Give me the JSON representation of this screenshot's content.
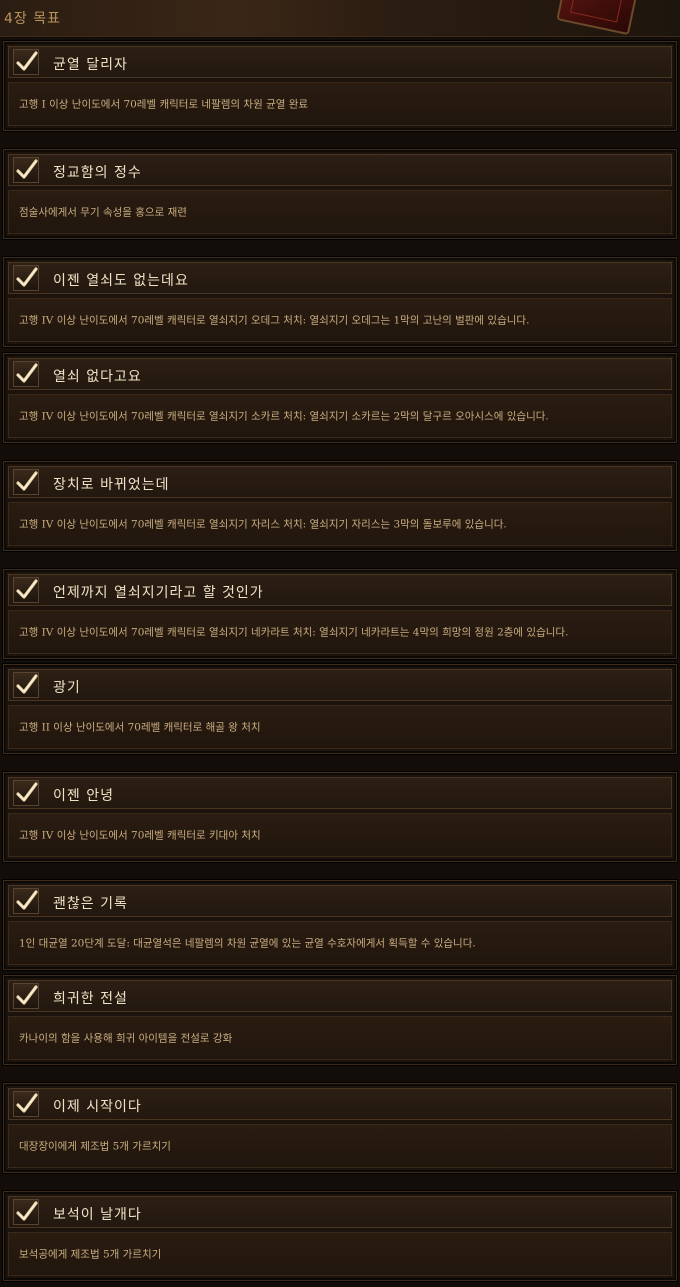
{
  "chapter_title": "4장 목표",
  "achievements": [
    {
      "title": "균열 달리자",
      "description": "고행 I 이상 난이도에서 70레벨 캐릭터로 네팔렘의 차원 균열 완료",
      "completed": true
    },
    {
      "title": "정교함의 정수",
      "description": "점술사에게서 무기 속성을 홍으로 재련",
      "completed": true
    },
    {
      "title": "이젠 열쇠도 없는데요",
      "description": "고행 IV 이상 난이도에서 70레벨 캐릭터로 열쇠지기 오데그 처치: 열쇠지기 오데그는 1막의 고난의 벌판에 있습니다.",
      "completed": true
    },
    {
      "title": "열쇠 없다고요",
      "description": "고행 IV 이상 난이도에서 70레벨 캐릭터로 열쇠지기 소카르 처치: 열쇠지기 소카르는 2막의 달구르 오아시스에 있습니다.",
      "completed": true
    },
    {
      "title": "장치로 바뀌었는데",
      "description": "고행 IV 이상 난이도에서 70레벨 캐릭터로 열쇠지기 자리스 처치: 열쇠지기 자리스는 3막의 돌보루에 있습니다.",
      "completed": true
    },
    {
      "title": "언제까지 열쇠지기라고 할 것인가",
      "description": "고행 IV 이상 난이도에서 70레벨 캐릭터로 열쇠지기 네카라트 처치: 열쇠지기 네카라트는 4막의 희망의 정원 2층에 있습니다.",
      "completed": true
    },
    {
      "title": "광기",
      "description": "고행 II 이상 난이도에서 70레벨 캐릭터로 해골 왕 처치",
      "completed": true
    },
    {
      "title": "이젠 안녕",
      "description": "고행 IV 이상 난이도에서 70레벨 캐릭터로 키대아 처치",
      "completed": true
    },
    {
      "title": "괜찮은 기록",
      "description": "1인 대균열 20단계 도달: 대균열석은 네팔렘의 차원 균열에 있는 균열 수호자에게서 획득할 수 있습니다.",
      "completed": true
    },
    {
      "title": "희귀한 전설",
      "description": "카나이의 함을 사용해 희귀 아이템을 전설로 강화",
      "completed": true
    },
    {
      "title": "이제 시작이다",
      "description": "대장장이에게 제조법 5개 가르치기",
      "completed": true
    },
    {
      "title": "보석이 날개다",
      "description": "보석공에게 제조법 5개 가르치기",
      "completed": true
    }
  ]
}
